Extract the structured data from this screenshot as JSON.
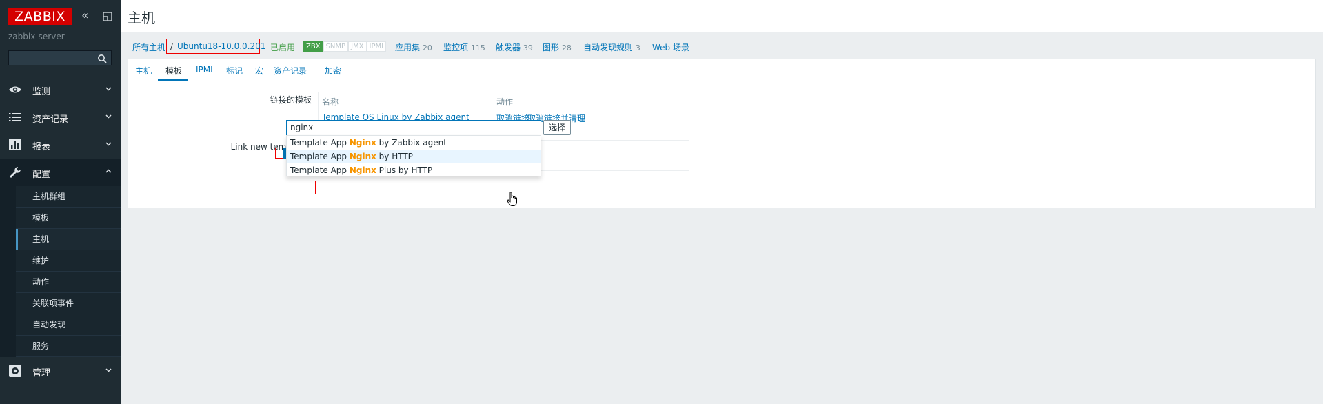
{
  "sidebar": {
    "logo": "ZABBIX",
    "server_name": "zabbix-server",
    "menu": [
      {
        "label": "监测",
        "icon": "eye-icon"
      },
      {
        "label": "资产记录",
        "icon": "list-icon"
      },
      {
        "label": "报表",
        "icon": "bar-chart-icon"
      },
      {
        "label": "配置",
        "icon": "wrench-icon"
      },
      {
        "label": "管理",
        "icon": "gear-icon"
      }
    ],
    "config_submenu": [
      "主机群组",
      "模板",
      "主机",
      "维护",
      "动作",
      "关联项事件",
      "自动发现",
      "服务"
    ],
    "active_sub": "主机"
  },
  "header": {
    "title": "主机"
  },
  "nav": {
    "all_hosts": "所有主机",
    "separator": "/",
    "host": "Ubuntu18-10.0.0.201",
    "enabled": "已启用",
    "availability": [
      "ZBX",
      "SNMP",
      "JMX",
      "IPMI"
    ],
    "links": [
      {
        "label": "应用集",
        "count": "20"
      },
      {
        "label": "监控项",
        "count": "115"
      },
      {
        "label": "触发器",
        "count": "39"
      },
      {
        "label": "图形",
        "count": "28"
      },
      {
        "label": "自动发现规则",
        "count": "3"
      },
      {
        "label": "Web 场景",
        "count": ""
      }
    ]
  },
  "tabs": [
    "主机",
    "模板",
    "IPMI",
    "标记",
    "宏",
    "资产记录",
    "加密"
  ],
  "active_tab": "模板",
  "linked": {
    "label": "链接的模板",
    "col_name": "名称",
    "col_action": "动作",
    "template": "Template OS Linux by Zabbix agent",
    "unlink": "取消链接",
    "unlink_clear": "取消链接并清理"
  },
  "new_templates": {
    "label": "Link new templates",
    "input_value": "nginx",
    "select_button": "选择",
    "suggestions": [
      {
        "pre": "Template App ",
        "match": "Nginx",
        "post": " by Zabbix agent"
      },
      {
        "pre": "Template App ",
        "match": "Nginx",
        "post": " by HTTP"
      },
      {
        "pre": "Template App ",
        "match": "Nginx",
        "post": " Plus by HTTP"
      }
    ]
  }
}
